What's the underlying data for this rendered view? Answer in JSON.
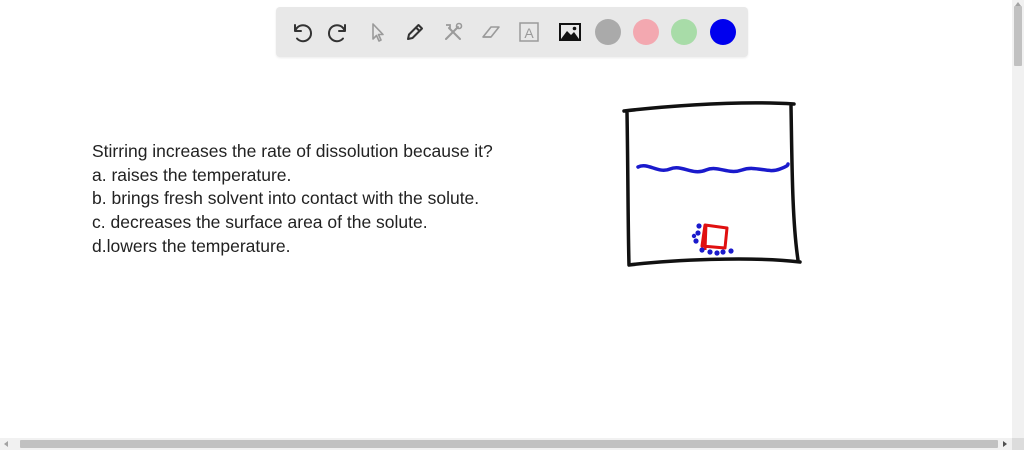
{
  "toolbar": {
    "tools": [
      {
        "name": "undo",
        "icon": "undo-icon"
      },
      {
        "name": "redo",
        "icon": "redo-icon"
      },
      {
        "name": "select",
        "icon": "pointer-icon"
      },
      {
        "name": "pen",
        "icon": "pencil-icon"
      },
      {
        "name": "tools",
        "icon": "wrench-hammer-icon"
      },
      {
        "name": "eraser",
        "icon": "eraser-icon"
      },
      {
        "name": "text",
        "icon": "text-box-icon"
      },
      {
        "name": "image",
        "icon": "image-icon"
      }
    ],
    "text_tool_glyph": "A",
    "colors": [
      {
        "name": "gray",
        "hex": "#aaaaaa"
      },
      {
        "name": "pink",
        "hex": "#f3a8b0"
      },
      {
        "name": "green",
        "hex": "#a8dca8"
      },
      {
        "name": "blue",
        "hex": "#0000ee"
      }
    ]
  },
  "question": {
    "stem": "Stirring increases the rate of dissolution because it?",
    "options": [
      "a. raises the temperature.",
      "b. brings fresh solvent into contact with the solute.",
      "c. decreases the surface area of the solute.",
      "d.lowers the temperature."
    ]
  },
  "drawing": {
    "description_icon": "beaker-sketch",
    "colors": {
      "outline": "#111111",
      "water": "#1a1acc",
      "solute": "#e01010",
      "particles": "#1a1acc"
    }
  }
}
